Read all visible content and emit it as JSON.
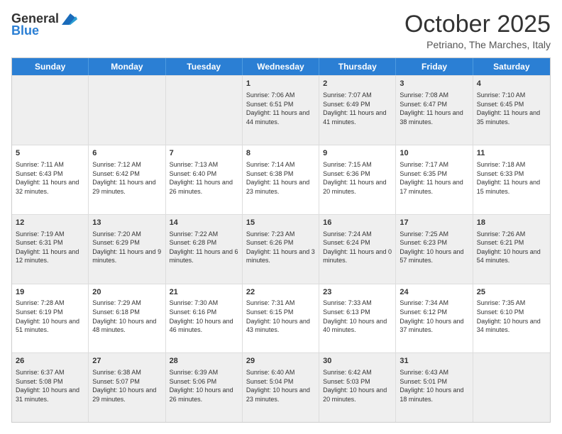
{
  "logo": {
    "line1": "General",
    "line2": "Blue"
  },
  "header": {
    "month": "October 2025",
    "location": "Petriano, The Marches, Italy"
  },
  "weekdays": [
    "Sunday",
    "Monday",
    "Tuesday",
    "Wednesday",
    "Thursday",
    "Friday",
    "Saturday"
  ],
  "rows": [
    [
      {
        "day": "",
        "text": ""
      },
      {
        "day": "",
        "text": ""
      },
      {
        "day": "",
        "text": ""
      },
      {
        "day": "1",
        "text": "Sunrise: 7:06 AM\nSunset: 6:51 PM\nDaylight: 11 hours and 44 minutes."
      },
      {
        "day": "2",
        "text": "Sunrise: 7:07 AM\nSunset: 6:49 PM\nDaylight: 11 hours and 41 minutes."
      },
      {
        "day": "3",
        "text": "Sunrise: 7:08 AM\nSunset: 6:47 PM\nDaylight: 11 hours and 38 minutes."
      },
      {
        "day": "4",
        "text": "Sunrise: 7:10 AM\nSunset: 6:45 PM\nDaylight: 11 hours and 35 minutes."
      }
    ],
    [
      {
        "day": "5",
        "text": "Sunrise: 7:11 AM\nSunset: 6:43 PM\nDaylight: 11 hours and 32 minutes."
      },
      {
        "day": "6",
        "text": "Sunrise: 7:12 AM\nSunset: 6:42 PM\nDaylight: 11 hours and 29 minutes."
      },
      {
        "day": "7",
        "text": "Sunrise: 7:13 AM\nSunset: 6:40 PM\nDaylight: 11 hours and 26 minutes."
      },
      {
        "day": "8",
        "text": "Sunrise: 7:14 AM\nSunset: 6:38 PM\nDaylight: 11 hours and 23 minutes."
      },
      {
        "day": "9",
        "text": "Sunrise: 7:15 AM\nSunset: 6:36 PM\nDaylight: 11 hours and 20 minutes."
      },
      {
        "day": "10",
        "text": "Sunrise: 7:17 AM\nSunset: 6:35 PM\nDaylight: 11 hours and 17 minutes."
      },
      {
        "day": "11",
        "text": "Sunrise: 7:18 AM\nSunset: 6:33 PM\nDaylight: 11 hours and 15 minutes."
      }
    ],
    [
      {
        "day": "12",
        "text": "Sunrise: 7:19 AM\nSunset: 6:31 PM\nDaylight: 11 hours and 12 minutes."
      },
      {
        "day": "13",
        "text": "Sunrise: 7:20 AM\nSunset: 6:29 PM\nDaylight: 11 hours and 9 minutes."
      },
      {
        "day": "14",
        "text": "Sunrise: 7:22 AM\nSunset: 6:28 PM\nDaylight: 11 hours and 6 minutes."
      },
      {
        "day": "15",
        "text": "Sunrise: 7:23 AM\nSunset: 6:26 PM\nDaylight: 11 hours and 3 minutes."
      },
      {
        "day": "16",
        "text": "Sunrise: 7:24 AM\nSunset: 6:24 PM\nDaylight: 11 hours and 0 minutes."
      },
      {
        "day": "17",
        "text": "Sunrise: 7:25 AM\nSunset: 6:23 PM\nDaylight: 10 hours and 57 minutes."
      },
      {
        "day": "18",
        "text": "Sunrise: 7:26 AM\nSunset: 6:21 PM\nDaylight: 10 hours and 54 minutes."
      }
    ],
    [
      {
        "day": "19",
        "text": "Sunrise: 7:28 AM\nSunset: 6:19 PM\nDaylight: 10 hours and 51 minutes."
      },
      {
        "day": "20",
        "text": "Sunrise: 7:29 AM\nSunset: 6:18 PM\nDaylight: 10 hours and 48 minutes."
      },
      {
        "day": "21",
        "text": "Sunrise: 7:30 AM\nSunset: 6:16 PM\nDaylight: 10 hours and 46 minutes."
      },
      {
        "day": "22",
        "text": "Sunrise: 7:31 AM\nSunset: 6:15 PM\nDaylight: 10 hours and 43 minutes."
      },
      {
        "day": "23",
        "text": "Sunrise: 7:33 AM\nSunset: 6:13 PM\nDaylight: 10 hours and 40 minutes."
      },
      {
        "day": "24",
        "text": "Sunrise: 7:34 AM\nSunset: 6:12 PM\nDaylight: 10 hours and 37 minutes."
      },
      {
        "day": "25",
        "text": "Sunrise: 7:35 AM\nSunset: 6:10 PM\nDaylight: 10 hours and 34 minutes."
      }
    ],
    [
      {
        "day": "26",
        "text": "Sunrise: 6:37 AM\nSunset: 5:08 PM\nDaylight: 10 hours and 31 minutes."
      },
      {
        "day": "27",
        "text": "Sunrise: 6:38 AM\nSunset: 5:07 PM\nDaylight: 10 hours and 29 minutes."
      },
      {
        "day": "28",
        "text": "Sunrise: 6:39 AM\nSunset: 5:06 PM\nDaylight: 10 hours and 26 minutes."
      },
      {
        "day": "29",
        "text": "Sunrise: 6:40 AM\nSunset: 5:04 PM\nDaylight: 10 hours and 23 minutes."
      },
      {
        "day": "30",
        "text": "Sunrise: 6:42 AM\nSunset: 5:03 PM\nDaylight: 10 hours and 20 minutes."
      },
      {
        "day": "31",
        "text": "Sunrise: 6:43 AM\nSunset: 5:01 PM\nDaylight: 10 hours and 18 minutes."
      },
      {
        "day": "",
        "text": ""
      }
    ]
  ],
  "alt_rows": [
    0,
    2,
    4
  ]
}
